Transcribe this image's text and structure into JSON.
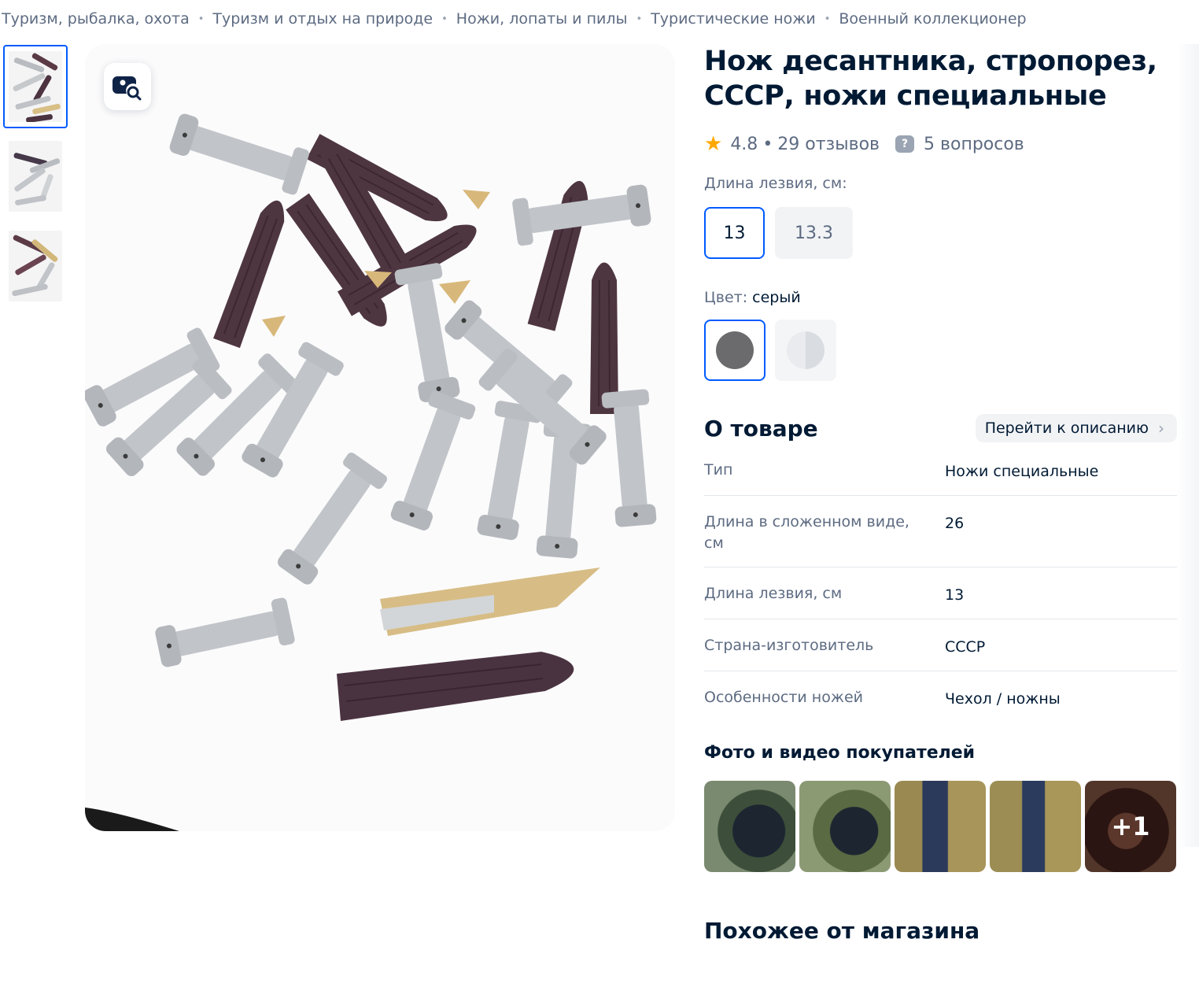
{
  "breadcrumbs": [
    "Туризм, рыбалка, охота",
    "Туризм и отдых на природе",
    "Ножи, лопаты и пилы",
    "Туристические ножи",
    "Военный коллекционер"
  ],
  "breadcrumb_separator": "•",
  "gallery": {
    "thumbnails": [
      "knives-photo-1",
      "knives-photo-2",
      "knives-photo-3"
    ],
    "active_index": 0,
    "lens_icon": "image-search-icon"
  },
  "product": {
    "title": "Нож десантника, стропорез, СССР, ножи специальные",
    "rating": "4.8",
    "rating_sep": "•",
    "reviews": "29 отзывов",
    "questions": "5 вопросов"
  },
  "blade_length": {
    "label": "Длина лезвия, см:",
    "options": [
      "13",
      "13.3"
    ],
    "selected": "13"
  },
  "color": {
    "label": "Цвет:",
    "value": "серый",
    "swatch_colors": [
      "#6b6b6d",
      "#e3e5e8"
    ]
  },
  "about": {
    "title": "О товаре",
    "link": "Перейти к описанию",
    "specs": [
      {
        "key": "Тип",
        "value": "Ножи специальные"
      },
      {
        "key": "Длина в сложенном виде, см",
        "value": "26"
      },
      {
        "key": "Длина лезвия, см",
        "value": "13"
      },
      {
        "key": "Страна-изготовитель",
        "value": "СССР"
      },
      {
        "key": "Особенности ножей",
        "value": "Чехол / ножны"
      }
    ]
  },
  "ugc": {
    "title": "Фото и видео покупателей",
    "more": "+1"
  },
  "similar_title": "Похожее от магазина",
  "colors": {
    "accent": "#005bff",
    "text": "#001a34",
    "muted": "#5d6b82",
    "star": "#ffa800"
  }
}
